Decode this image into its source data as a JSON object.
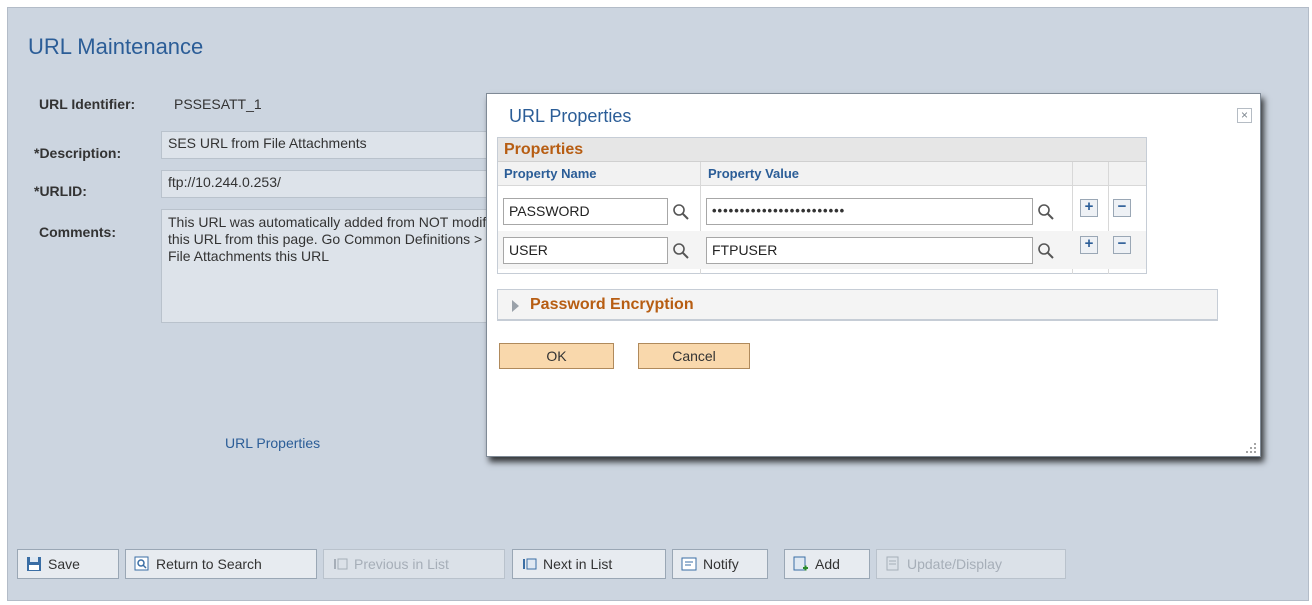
{
  "page": {
    "title": "URL Maintenance",
    "url_identifier_label": "URL Identifier:",
    "url_identifier_value": "PSSESATT_1",
    "description_label": "*Description:",
    "description_value": "SES URL from File Attachments",
    "urlid_label": "*URLID:",
    "urlid_value": "ftp://10.244.0.253/",
    "comments_label": "Comments:",
    "comments_value": "This URL was automatically added from NOT modify this URL from this page.  Go Common Definitions > File Attachments this URL",
    "url_properties_link": "URL Properties"
  },
  "toolbar": {
    "save": "Save",
    "return_to_search": "Return to Search",
    "previous_in_list": "Previous in List",
    "next_in_list": "Next in List",
    "notify": "Notify",
    "add": "Add",
    "update_display": "Update/Display"
  },
  "modal": {
    "title": "URL Properties",
    "close": "×",
    "grid_title": "Properties",
    "col_property_name": "Property Name",
    "col_property_value": "Property Value",
    "rows": [
      {
        "name": "PASSWORD",
        "value": "••••••••••••••••••••••••"
      },
      {
        "name": "USER",
        "value": "FTPUSER"
      }
    ],
    "section_title": "Password Encryption",
    "ok": "OK",
    "cancel": "Cancel"
  },
  "colors": {
    "link_blue": "#2b5d97",
    "orange_heading": "#b75d12",
    "page_bg": "#ccd5e0",
    "button_peach": "#f9d8ac"
  }
}
